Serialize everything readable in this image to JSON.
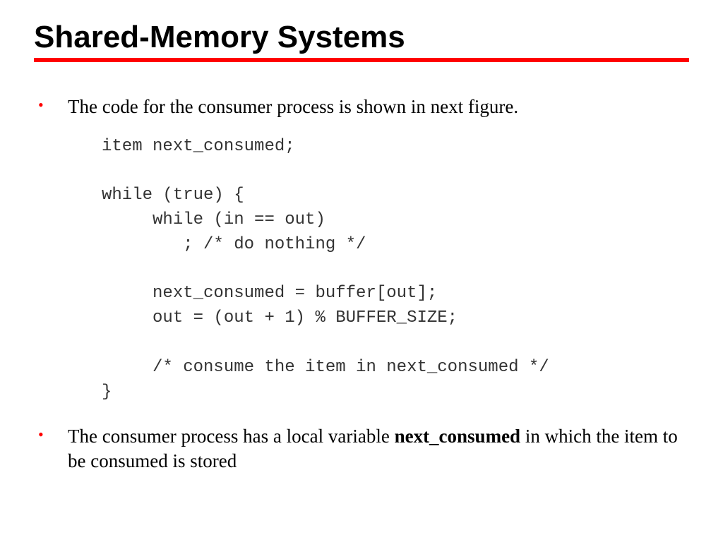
{
  "title": "Shared-Memory Systems",
  "bullets": [
    "The code for the consumer process is shown in next figure.",
    {
      "pre": "The consumer process has a local variable ",
      "bold": "next_consumed",
      "post": " in which the item to be consumed is stored"
    }
  ],
  "code": "item next_consumed;\n\nwhile (true) {\n     while (in == out)\n        ; /* do nothing */\n\n     next_consumed = buffer[out];\n     out = (out + 1) % BUFFER_SIZE;\n\n     /* consume the item in next_consumed */\n}"
}
